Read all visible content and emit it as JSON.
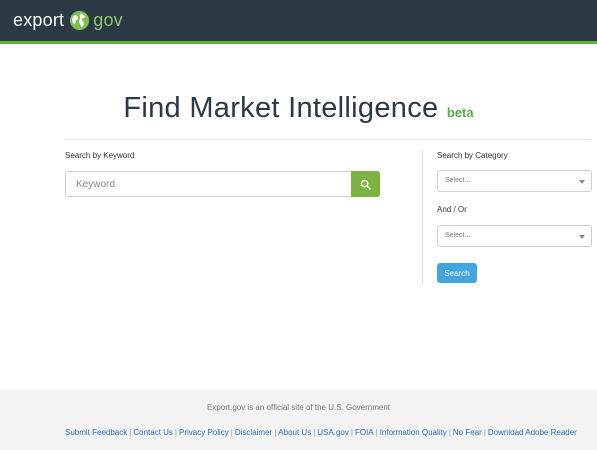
{
  "header": {
    "logo_left": "export",
    "logo_right": "gov",
    "background": "#2c3844",
    "accent": "#60b045"
  },
  "title": {
    "main": "Find Market Intelligence",
    "badge": "beta"
  },
  "keyword": {
    "label": "Search by Keyword",
    "placeholder": "Keyword",
    "button_icon": "search-icon"
  },
  "category": {
    "label": "Search by Category",
    "select_value": "Select..."
  },
  "andor": {
    "label": "And / Or",
    "select_value": "Select..."
  },
  "search_button": {
    "label": "Search",
    "color": "#42a5de"
  },
  "footer": {
    "note": "Export.gov is an official site of the U.S. Government",
    "links": [
      "Submit Feedback",
      "Contact Us",
      "Privacy Policy",
      "Disclaimer",
      "About Us",
      "USA.gov",
      "FOIA",
      "Information Quality",
      "No Fear",
      "Download Adobe Reader"
    ]
  }
}
